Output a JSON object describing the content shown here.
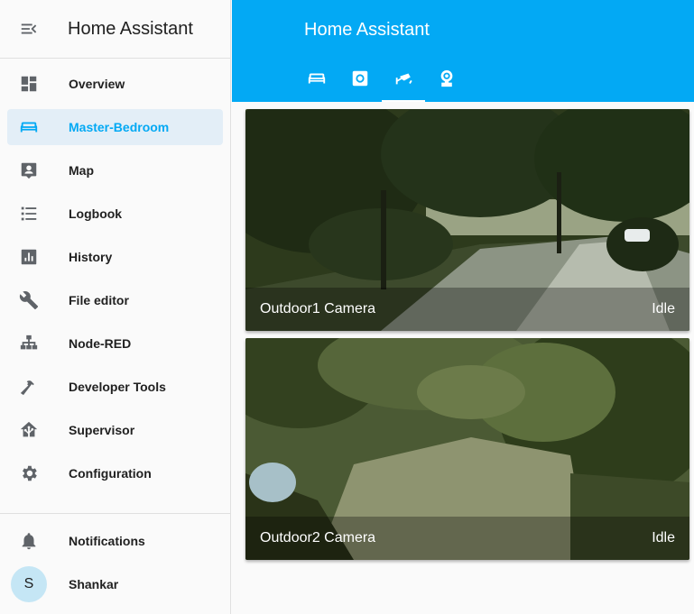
{
  "app": {
    "title": "Home Assistant"
  },
  "sidebar": {
    "items": [
      {
        "label": "Overview",
        "icon": "dashboard-icon"
      },
      {
        "label": "Master-Bedroom",
        "icon": "sofa-icon",
        "active": true
      },
      {
        "label": "Map",
        "icon": "account-box-icon"
      },
      {
        "label": "Logbook",
        "icon": "list-icon"
      },
      {
        "label": "History",
        "icon": "chart-box-icon"
      },
      {
        "label": "File editor",
        "icon": "wrench-icon"
      },
      {
        "label": "Node-RED",
        "icon": "sitemap-icon"
      },
      {
        "label": "Developer Tools",
        "icon": "hammer-icon"
      },
      {
        "label": "Supervisor",
        "icon": "home-assistant-icon"
      },
      {
        "label": "Configuration",
        "icon": "gear-icon"
      }
    ],
    "notifications_label": "Notifications",
    "user": {
      "name": "Shankar",
      "initial": "S"
    }
  },
  "header": {
    "title": "Home Assistant",
    "tabs": [
      {
        "icon": "sofa-icon"
      },
      {
        "icon": "washing-icon"
      },
      {
        "icon": "cctv-icon",
        "active": true
      },
      {
        "icon": "webcam-icon"
      }
    ]
  },
  "cards": [
    {
      "name": "Outdoor1 Camera",
      "state": "Idle"
    },
    {
      "name": "Outdoor2 Camera",
      "state": "Idle"
    }
  ],
  "colors": {
    "primary": "#03a9f4",
    "sidebar_active_bg": "#e3eef7",
    "icon": "#5f6368"
  }
}
